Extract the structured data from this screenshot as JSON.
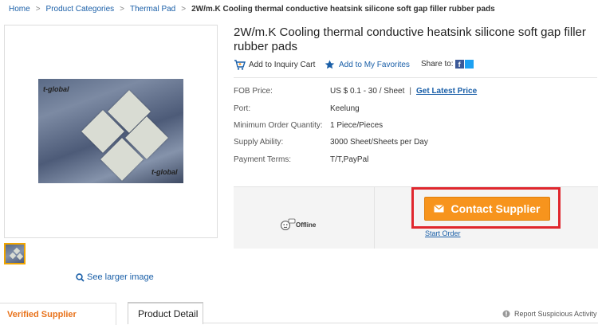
{
  "breadcrumb": {
    "home": "Home",
    "categories": "Product Categories",
    "category": "Thermal Pad",
    "current": "2W/m.K Cooling thermal conductive heatsink silicone soft gap filler rubber pads",
    "separator": ">"
  },
  "gallery": {
    "photo_logo": "t-global",
    "see_larger": "See larger image"
  },
  "product": {
    "title": "2W/m.K Cooling thermal conductive heatsink silicone soft gap filler rubber pads",
    "add_to_cart": "Add to Inquiry Cart",
    "add_to_favorites": "Add to My Favorites",
    "share_to": "Share to:"
  },
  "specs": [
    {
      "label": "FOB Price:",
      "value": "US $ 0.1 - 30 / Sheet",
      "link": "Get Latest Price",
      "divider": "|"
    },
    {
      "label": "Port:",
      "value": "Keelung"
    },
    {
      "label": "Minimum Order Quantity:",
      "value": "1 Piece/Pieces"
    },
    {
      "label": "Supply Ability:",
      "value": "3000 Sheet/Sheets per Day"
    },
    {
      "label": "Payment Terms:",
      "value": "T/T,PayPal"
    }
  ],
  "contact": {
    "status": "Offline",
    "button": "Contact Supplier",
    "start_order": "Start Order"
  },
  "tabs": {
    "verified_supplier": "Verified Supplier",
    "product_detail": "Product Detail",
    "report": "Report Suspicious Activity"
  },
  "colors": {
    "link": "#1a5fa8",
    "accent_orange": "#f7941d",
    "highlight_red": "#e0272e",
    "verified_orange": "#e8731c"
  }
}
